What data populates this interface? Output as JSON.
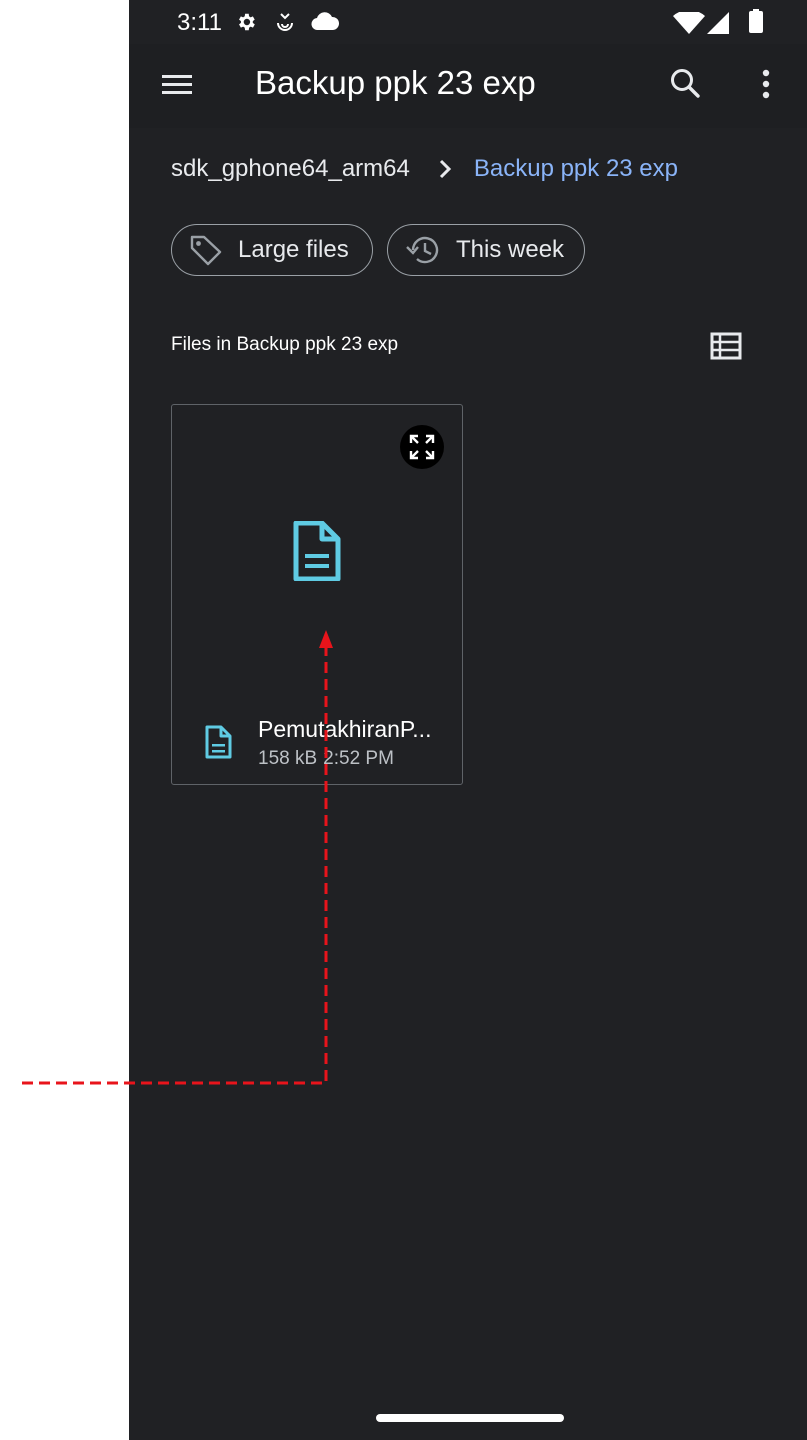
{
  "status_bar": {
    "time": "3:11",
    "icons": [
      "settings-icon",
      "cast-icon",
      "cloud-icon",
      "wifi-icon",
      "cellular-icon",
      "battery-icon"
    ]
  },
  "app_bar": {
    "title": "Backup ppk 23 exp",
    "icons": [
      "menu-icon",
      "search-icon",
      "more-vert-icon"
    ]
  },
  "breadcrumb": {
    "root": "sdk_gphone64_arm64",
    "current": "Backup ppk 23 exp"
  },
  "chips": [
    {
      "label": "Large files",
      "icon": "tag-icon"
    },
    {
      "label": "This week",
      "icon": "history-icon"
    }
  ],
  "section": {
    "title": "Files in Backup ppk 23 exp",
    "view_toggle_icon": "list-view-icon"
  },
  "files": [
    {
      "name": "PemutakhiranP...",
      "size": "158 kB",
      "time": "2:52 PM",
      "icon": "document-icon"
    }
  ],
  "colors": {
    "background": "#202124",
    "accent": "#8ab4f8",
    "document_icon": "#5fcbe3",
    "annotation": "#e8141b"
  }
}
